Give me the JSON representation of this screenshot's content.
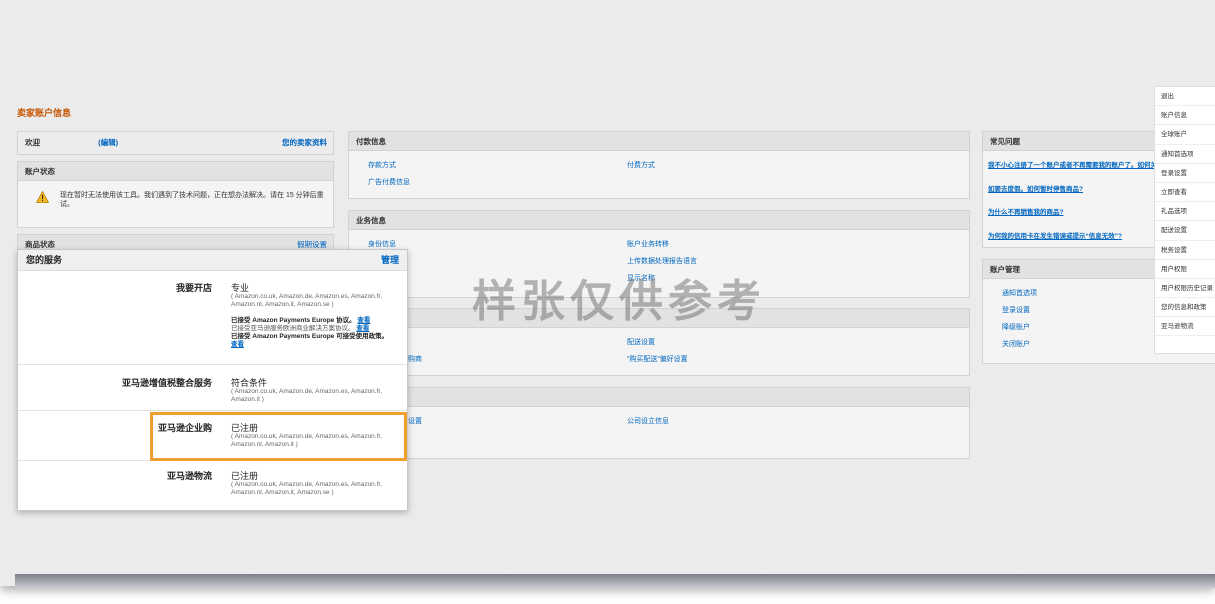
{
  "page_title": "卖家账户信息",
  "welcome": {
    "label": "欢迎",
    "edit": "(编辑)",
    "profile_link": "您的卖家资料"
  },
  "account_status": {
    "title": "账户状态",
    "message": "现在暂时无法使用该工具。我们遇到了技术问题，正在想办法解决。请在 15 分钟后重试。"
  },
  "product_status": {
    "title": "商品状态",
    "holiday_settings": "假期设置"
  },
  "payment_info": {
    "title": "付款信息",
    "links": [
      "存款方式",
      "广告付费信息",
      "付费方式"
    ]
  },
  "business_info": {
    "title": "业务信息",
    "links": [
      "身份信息",
      "账户业务转移",
      "上传数据处理报告语言",
      "显示名称"
    ]
  },
  "shipping": {
    "links": [
      "配送设置",
      "“购买配送”偏好设置",
      "…购商"
    ]
  },
  "tax": {
    "links": [
      "…设置",
      "公司设立信息"
    ]
  },
  "faq": {
    "title": "常见问题",
    "links": [
      "我不小心注册了一个账户或者不再需要我的账户了。如何关…",
      "如要去度假。如何暂时停售商品?",
      "为什么不再销售我的商品?",
      "为何我的信用卡在发生错误或提示“信息无效”?"
    ]
  },
  "account_management": {
    "title": "账户管理",
    "links": [
      "通知首选项",
      "登录设置",
      "降级账户",
      "关闭账户"
    ]
  },
  "watermark": "样张仅供参考",
  "services": {
    "title": "您的服务",
    "manage": "管理",
    "rows": [
      {
        "name": "我要开店",
        "status": "专业",
        "sites": "( Amazon.co.uk, Amazon.de, Amazon.es, Amazon.fr, Amazon.nl, Amazon.it, Amazon.se )",
        "notes": [
          {
            "text": "已接受 Amazon Payments Europe 协议。",
            "link": "查看"
          },
          {
            "text": "已接受亚马逊服务欧洲商业解决方案协议。",
            "link": "查看"
          },
          {
            "text": "已接受 Amazon Payments Europe 可接受使用政策。",
            "link": "查看"
          }
        ]
      },
      {
        "name": "亚马逊增值税整合服务",
        "status": "符合条件",
        "sites": "( Amazon.co.uk, Amazon.de, Amazon.es, Amazon.fr, Amazon.it )"
      },
      {
        "name": "亚马逊企业购",
        "status": "已注册",
        "sites": "( Amazon.co.uk, Amazon.de, Amazon.es, Amazon.fr, Amazon.nl, Amazon.it )"
      },
      {
        "name": "亚马逊物流",
        "status": "已注册",
        "sites": "( Amazon.co.uk, Amazon.de, Amazon.es, Amazon.fr, Amazon.nl, Amazon.it, Amazon.se )"
      }
    ]
  },
  "dropdown_menu": [
    "退出",
    "账户信息",
    "全球账户",
    "通知首选项",
    "登录设置",
    "立即查看",
    "礼品选项",
    "配送设置",
    "税务设置",
    "用户权限",
    "用户权限历史记录",
    "您的信息和政策",
    "亚马逊物流"
  ],
  "colors": {
    "title_orange": "#c45500",
    "link_blue": "#0066c0",
    "highlight": "#f0a030"
  }
}
